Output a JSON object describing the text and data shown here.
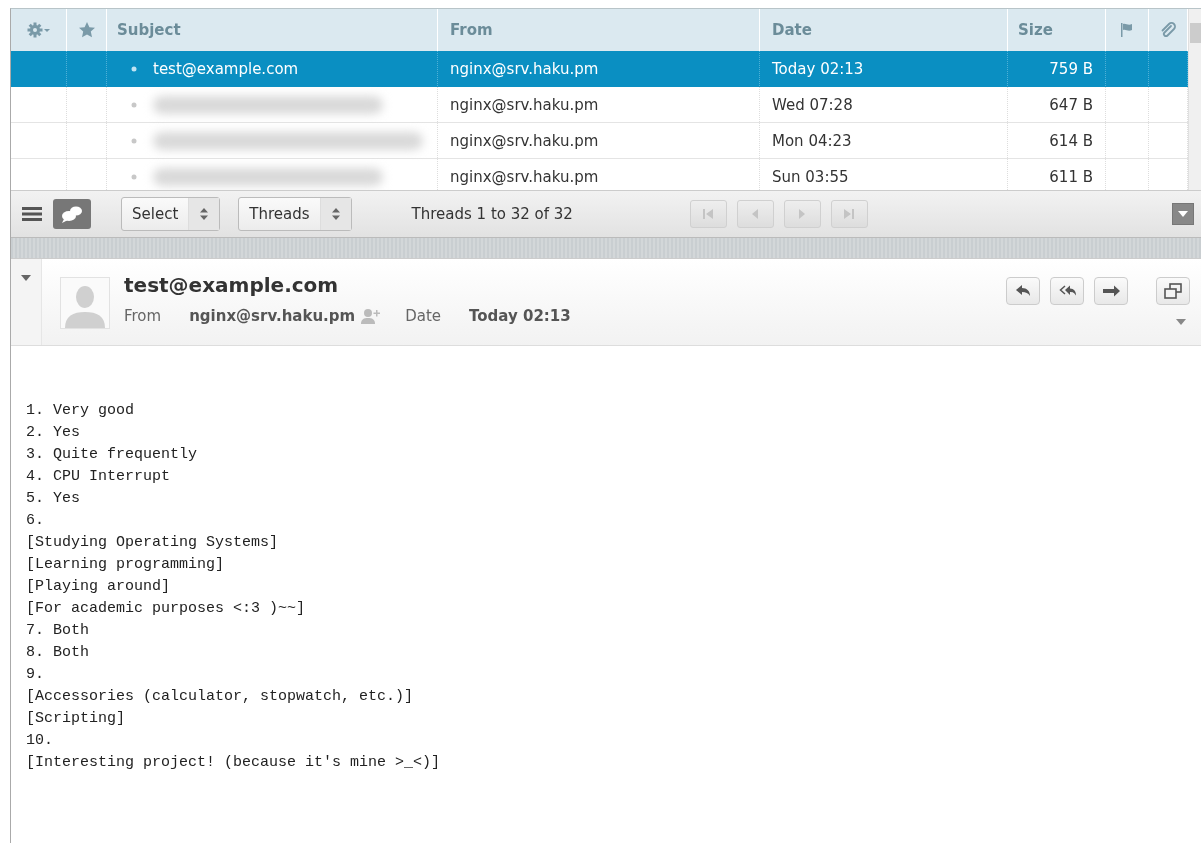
{
  "message_list": {
    "columns": [
      {
        "kind": "settings"
      },
      {
        "kind": "star"
      },
      {
        "kind": "text",
        "label": "Subject"
      },
      {
        "kind": "text",
        "label": "From"
      },
      {
        "kind": "text",
        "label": "Date"
      },
      {
        "kind": "text",
        "label": "Size"
      },
      {
        "kind": "flag"
      },
      {
        "kind": "attachment"
      }
    ],
    "rows": [
      {
        "subject": "test@example.com",
        "blurred": false,
        "from": "nginx@srv.haku.pm",
        "date": "Today 02:13",
        "size": "759 B",
        "selected": true
      },
      {
        "blurred": true,
        "from": "nginx@srv.haku.pm",
        "date": "Wed 07:28",
        "size": "647 B",
        "selected": false
      },
      {
        "blurred": true,
        "from": "nginx@srv.haku.pm",
        "date": "Mon 04:23",
        "size": "614 B",
        "selected": false
      },
      {
        "blurred": true,
        "from": "nginx@srv.haku.pm",
        "date": "Sun 03:55",
        "size": "611 B",
        "selected": false
      }
    ]
  },
  "toolbar": {
    "view_modes": [
      {
        "kind": "list",
        "selected": false
      },
      {
        "kind": "threads",
        "selected": true
      }
    ],
    "selects": [
      "Select",
      "Threads"
    ],
    "count": "Threads 1 to 32 of 32",
    "pager": [
      {
        "kind": "first",
        "disabled": true
      },
      {
        "kind": "prev",
        "disabled": true
      },
      {
        "kind": "next",
        "disabled": true
      },
      {
        "kind": "last",
        "disabled": true
      }
    ]
  },
  "message": {
    "subject": "test@example.com",
    "from_label": "From",
    "from": "nginx@srv.haku.pm",
    "date_label": "Date",
    "date": "Today 02:13",
    "body": [
      "1. Very good",
      "2. Yes",
      "3. Quite frequently",
      "4. CPU Interrupt",
      "5. Yes",
      "6.",
      "[Studying Operating Systems]",
      "[Learning programming]",
      "[Playing around]",
      "[For academic purposes <:3 )~~]",
      "7. Both",
      "8. Both",
      "9.",
      "[Accessories (calculator, stopwatch, etc.)]",
      "[Scripting]",
      "10.",
      "[Interesting project! (because it's mine >_<)]"
    ]
  }
}
